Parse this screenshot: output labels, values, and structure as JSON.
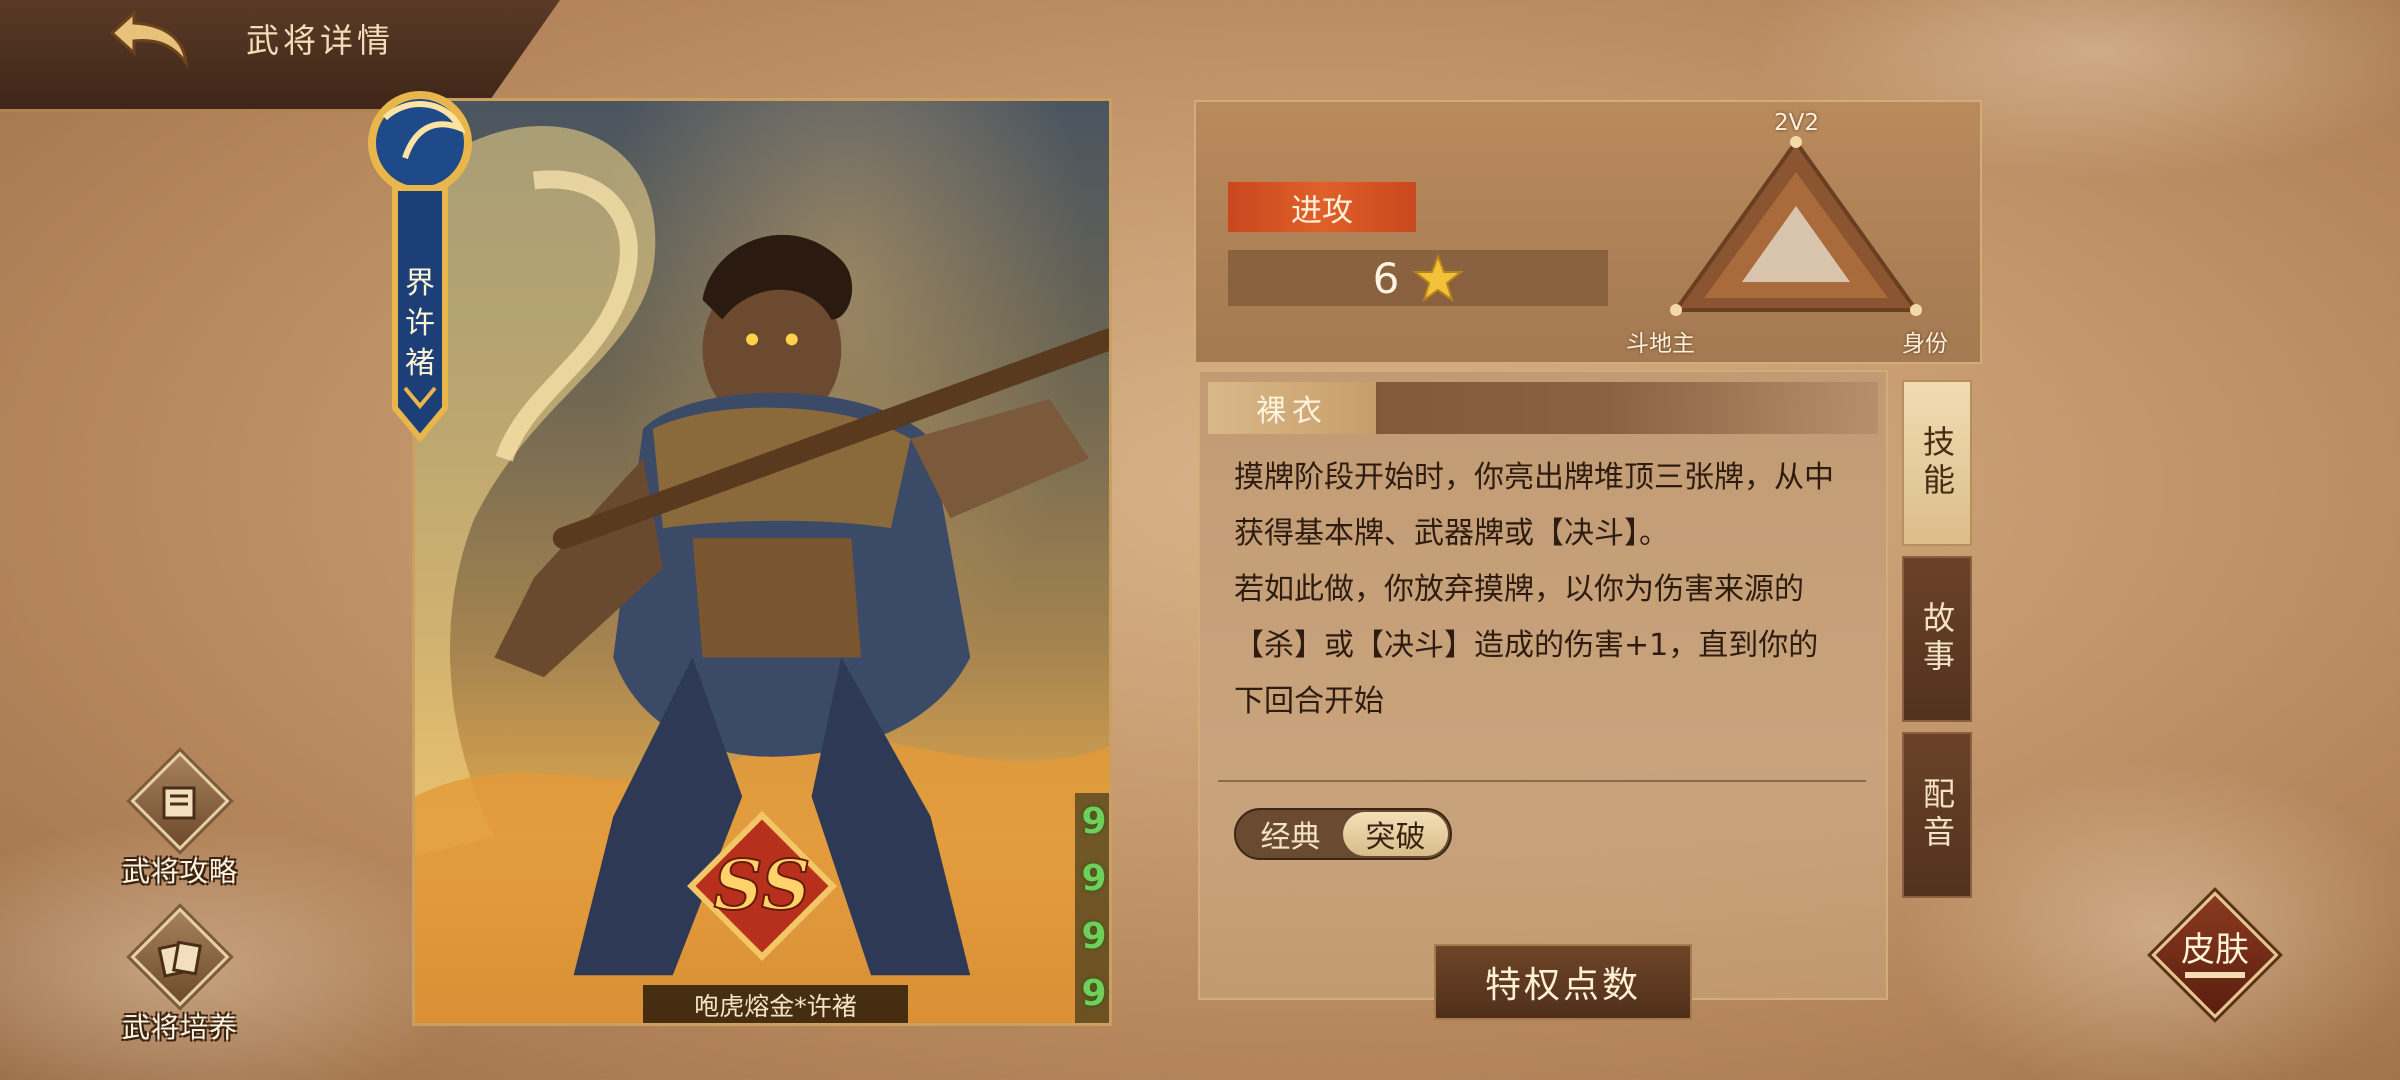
{
  "header": {
    "title": "武将详情"
  },
  "card": {
    "hero_name": "界许褚",
    "grade": "SS",
    "skin_name": "咆虎熔金*许褚",
    "side_marks": [
      "9",
      "9",
      "9",
      "9"
    ]
  },
  "side_buttons": {
    "guide_label": "武将攻略",
    "train_label": "武将培养"
  },
  "stats": {
    "role": "进攻",
    "rating": "6",
    "radar_labels": {
      "top": "2V2",
      "left": "斗地主",
      "right": "身份"
    }
  },
  "skill": {
    "name": "裸衣",
    "paragraph1": "摸牌阶段开始时，你亮出牌堆顶三张牌，从中获得基本牌、武器牌或【决斗】。",
    "paragraph2": "若如此做，你放弃摸牌，以你为伤害来源的【杀】或【决斗】造成的伤害+1，直到你的下回合开始",
    "mode_classic": "经典",
    "mode_breakthrough": "突破",
    "selected_mode": "突破"
  },
  "tabs": {
    "skill": "技能",
    "story": "故事",
    "voice": "配音",
    "selected": "技能"
  },
  "buttons": {
    "privilege": "特权点数",
    "skin": "皮肤"
  },
  "colors": {
    "accent_red": "#d8521f",
    "gold": "#c9a060",
    "star": "#f3c13a",
    "mark_green": "#6fcf5a"
  }
}
